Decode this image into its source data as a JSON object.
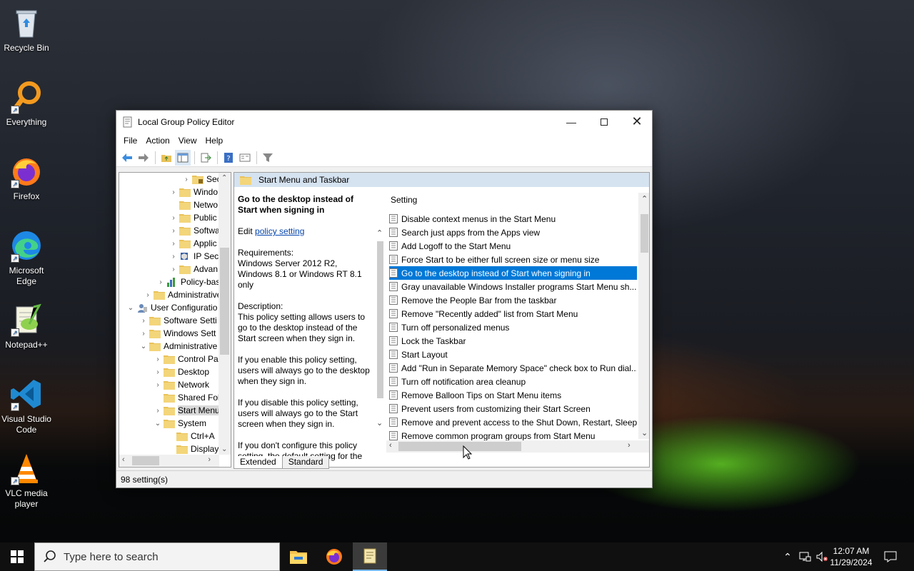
{
  "desktop": {
    "icons": [
      {
        "label": "Recycle Bin"
      },
      {
        "label": "Everything"
      },
      {
        "label": "Firefox"
      },
      {
        "label": "Microsoft Edge"
      },
      {
        "label": "Notepad++"
      },
      {
        "label": "Visual Studio Code"
      },
      {
        "label": "VLC media player"
      }
    ]
  },
  "window": {
    "title": "Local Group Policy Editor",
    "menu": [
      "File",
      "Action",
      "View",
      "Help"
    ],
    "tree": [
      {
        "label": "Sec",
        "expander": "›"
      },
      {
        "label": "Windo",
        "expander": "›"
      },
      {
        "label": "Netwo",
        "expander": ""
      },
      {
        "label": "Public",
        "expander": "›"
      },
      {
        "label": "Softwa",
        "expander": "›"
      },
      {
        "label": "Applic",
        "expander": "›"
      },
      {
        "label": "IP Secu",
        "expander": "›"
      },
      {
        "label": "Advan",
        "expander": "›"
      },
      {
        "label": "Policy-bas",
        "expander": "›"
      },
      {
        "label": "Administrative",
        "expander": "›"
      },
      {
        "label": "User Configuratio",
        "expander": "⌄"
      },
      {
        "label": "Software Setti",
        "expander": "›"
      },
      {
        "label": "Windows Sett",
        "expander": "›"
      },
      {
        "label": "Administrative",
        "expander": "⌄"
      },
      {
        "label": "Control Pa",
        "expander": "›"
      },
      {
        "label": "Desktop",
        "expander": "›"
      },
      {
        "label": "Network",
        "expander": "›"
      },
      {
        "label": "Shared Fol",
        "expander": ""
      },
      {
        "label": "Start Menu",
        "expander": "›"
      },
      {
        "label": "System",
        "expander": "⌄"
      },
      {
        "label": "Ctrl+A",
        "expander": ""
      },
      {
        "label": "Display",
        "expander": ""
      }
    ],
    "right_header": "Start Menu and Taskbar",
    "description": {
      "title": "Go to the desktop instead of Start when signing in",
      "edit_prefix": "Edit",
      "edit_link": "policy setting",
      "requirements_label": "Requirements:",
      "requirements": "Windows Server 2012 R2, Windows 8.1 or Windows RT 8.1 only",
      "description_label": "Description:",
      "p1": "This policy setting allows users to go to the desktop instead of the Start screen when they sign in.",
      "p2": "If you enable this policy setting, users will always go to the desktop when they sign in.",
      "p3": "If you disable this policy setting, users will always go to the Start screen when they sign in.",
      "p4": "If you don't configure this policy setting, the default setting for the"
    },
    "settings_header": "Setting",
    "settings": [
      "Disable context menus in the Start Menu",
      "Search just apps from the Apps view",
      "Add Logoff to the Start Menu",
      "Force Start to be either full screen size or menu size",
      "Go to the desktop instead of Start when signing in",
      "Gray unavailable Windows Installer programs Start Menu sh...",
      "Remove the People Bar from the taskbar",
      "Remove \"Recently added\" list from Start Menu",
      "Turn off personalized menus",
      "Lock the Taskbar",
      "Start Layout",
      "Add \"Run in Separate Memory Space\" check box to Run dial...",
      "Turn off notification area cleanup",
      "Remove Balloon Tips on Start Menu items",
      "Prevent users from customizing their Start Screen",
      "Remove and prevent access to the Shut Down, Restart, Sleep...",
      "Remove common program groups from Start Menu"
    ],
    "tabs": [
      "Extended",
      "Standard"
    ],
    "status": "98 setting(s)"
  },
  "taskbar": {
    "search_placeholder": "Type here to search",
    "time": "12:07 AM",
    "date": "11/29/2024"
  }
}
